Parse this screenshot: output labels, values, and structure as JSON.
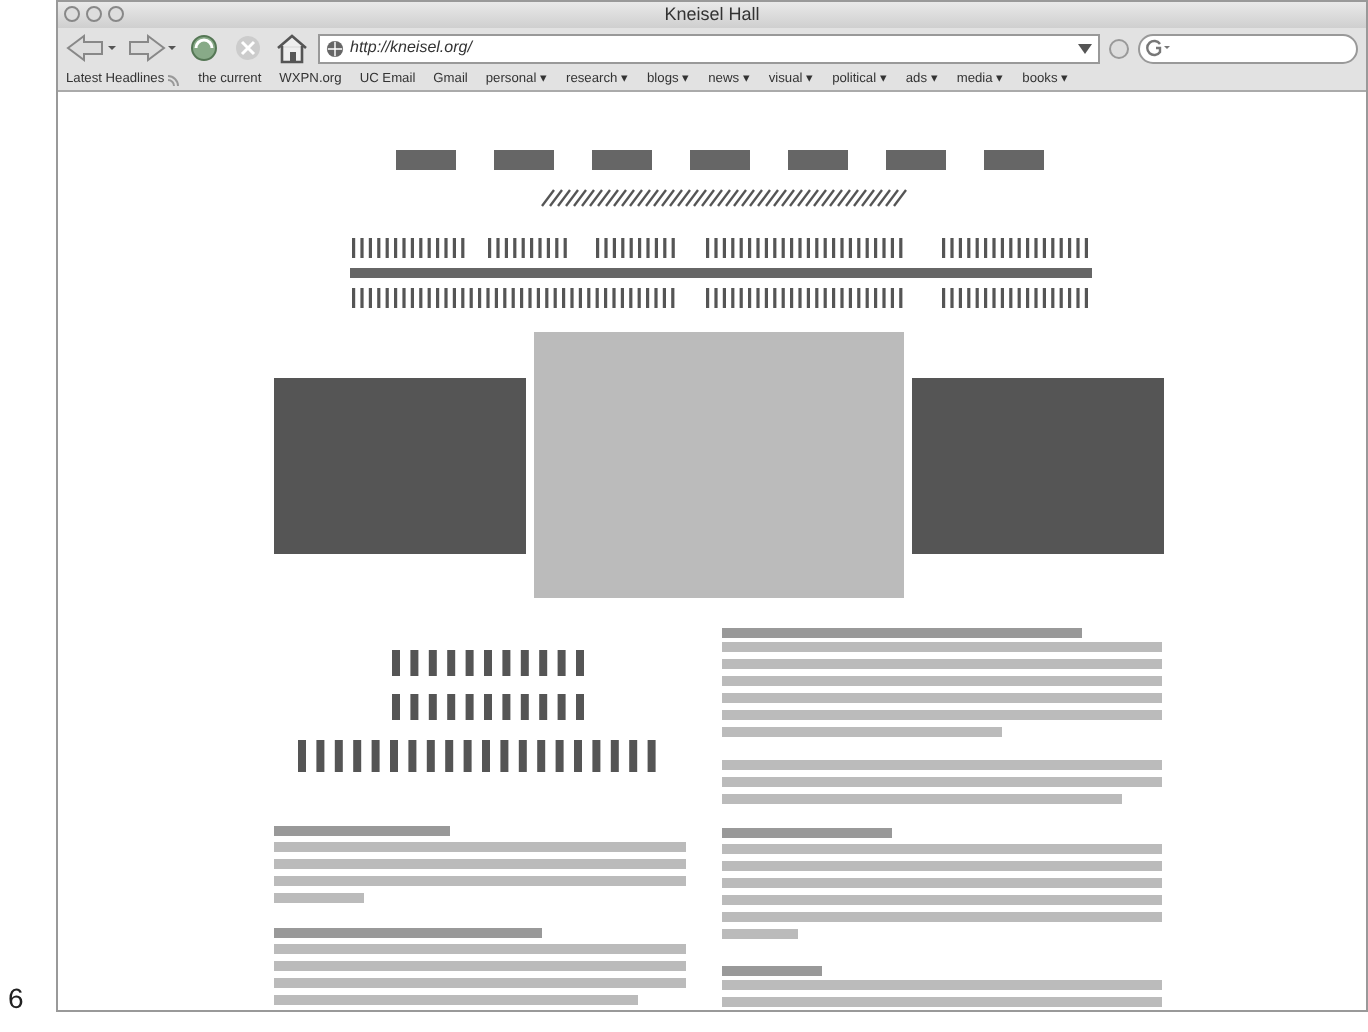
{
  "window": {
    "title": "Kneisel Hall"
  },
  "toolbar": {
    "url": "http://kneisel.org/"
  },
  "bookmarks": [
    {
      "label": "Latest Headlines",
      "kind": "feed"
    },
    {
      "label": "the current",
      "kind": "link"
    },
    {
      "label": "WXPN.org",
      "kind": "link"
    },
    {
      "label": "UC Email",
      "kind": "link"
    },
    {
      "label": "Gmail",
      "kind": "link"
    },
    {
      "label": "personal ▾",
      "kind": "folder"
    },
    {
      "label": "research ▾",
      "kind": "folder"
    },
    {
      "label": "blogs ▾",
      "kind": "folder"
    },
    {
      "label": "news ▾",
      "kind": "folder"
    },
    {
      "label": "visual ▾",
      "kind": "folder"
    },
    {
      "label": "political ▾",
      "kind": "folder"
    },
    {
      "label": "ads ▾",
      "kind": "folder"
    },
    {
      "label": "media ▾",
      "kind": "folder"
    },
    {
      "label": "books ▾",
      "kind": "folder"
    }
  ],
  "page_number": "6"
}
